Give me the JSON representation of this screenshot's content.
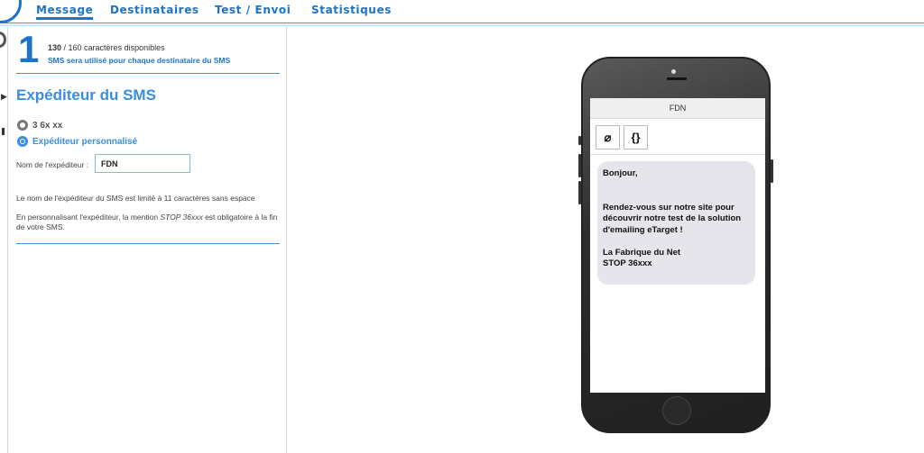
{
  "tabs": [
    {
      "label": "Message",
      "active": true
    },
    {
      "label": "Destinataires",
      "active": false
    },
    {
      "label": "Test / Envoi",
      "active": false
    },
    {
      "label": "Statistiques",
      "active": false
    }
  ],
  "step": {
    "number": "1",
    "chars_used": "130",
    "chars_rest": " / 160 caractères disponibles",
    "usage_note": "SMS sera utilisé pour chaque destinataire du SMS"
  },
  "sender": {
    "title": "Expéditeur du SMS",
    "option_default": "3 6x xx",
    "option_custom": "Expéditeur personnalisé",
    "selected": "custom",
    "field_label": "Nom de l'expéditeur :",
    "field_value": "FDN",
    "note_limit": "Le nom de l'expéditeur du SMS est limité à 11 caractères sans espace",
    "note_stop_prefix": "En personnalisant l'expéditeur, la mention ",
    "note_stop_em": "STOP 36xxx",
    "note_stop_suffix": " est obligatoire à la fin de votre SMS."
  },
  "preview": {
    "header": "FDN",
    "tools": [
      {
        "name": "unlink-icon",
        "glyph": "⌀"
      },
      {
        "name": "braces-icon",
        "glyph": "{}"
      }
    ],
    "message": "Bonjour,\n\n\nRendez-vous sur notre site pour découvrir notre test de la solution d'emailing eTarget !\n\nLa Fabrique du Net\nSTOP 36xxx"
  },
  "colors": {
    "accent": "#1e73c8",
    "title": "#3b8de0",
    "bubble": "#e6e5ec"
  }
}
